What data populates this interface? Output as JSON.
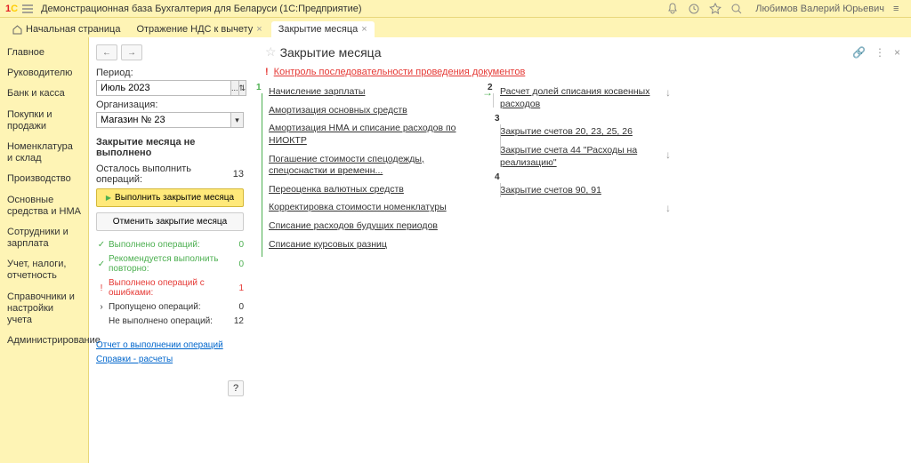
{
  "titlebar": {
    "app_title": "Демонстрационная база Бухгалтерия для Беларуси  (1С:Предприятие)",
    "user": "Любимов Валерий Юрьевич"
  },
  "tabs": {
    "home": "Начальная страница",
    "t1": "Отражение НДС к вычету",
    "t2": "Закрытие месяца"
  },
  "sidebar": {
    "items": [
      "Главное",
      "Руководителю",
      "Банк и касса",
      "Покупки и продажи",
      "Номенклатура и склад",
      "Производство",
      "Основные средства и НМА",
      "Сотрудники и зарплата",
      "Учет, налоги, отчетность",
      "Справочники и настройки учета",
      "Администрирование"
    ]
  },
  "page": {
    "title": "Закрытие месяца",
    "period_label": "Период:",
    "period_value": "Июль 2023",
    "org_label": "Организация:",
    "org_value": "Магазин № 23",
    "status_title": "Закрытие месяца не выполнено",
    "remain_label": "Осталось выполнить операций:",
    "remain_count": "13",
    "btn_execute": "Выполнить закрытие месяца",
    "btn_cancel": "Отменить закрытие месяца",
    "stats": {
      "done_label": "Выполнено операций:",
      "done_count": "0",
      "retry_label": "Рекомендуется выполнить повторно:",
      "retry_count": "0",
      "err_label": "Выполнено операций с ошибками:",
      "err_count": "1",
      "skip_label": "Пропущено операций:",
      "skip_count": "0",
      "notdone_label": "Не выполнено операций:",
      "notdone_count": "12"
    },
    "link_report": "Отчет о выполнении операций",
    "link_help": "Справки - расчеты",
    "help_q": "?"
  },
  "warn": {
    "text": "Контроль последовательности проведения документов"
  },
  "steps": {
    "s1": [
      "Начисление зарплаты",
      "Амортизация основных средств",
      "Амортизация НМА и списание расходов по НИОКТР",
      "Погашение стоимости спецодежды, спецоснастки и временн...",
      "Переоценка валютных средств",
      "Корректировка стоимости номенклатуры",
      "Списание расходов будущих периодов",
      "Списание курсовых разниц"
    ],
    "s2": [
      "Расчет долей списания косвенных расходов"
    ],
    "s3": [
      "Закрытие счетов 20, 23, 25, 26",
      "Закрытие счета 44 \"Расходы на реализацию\""
    ],
    "s4": [
      "Закрытие счетов 90, 91"
    ],
    "n1": "1",
    "n2": "2",
    "n3": "3",
    "n4": "4"
  }
}
